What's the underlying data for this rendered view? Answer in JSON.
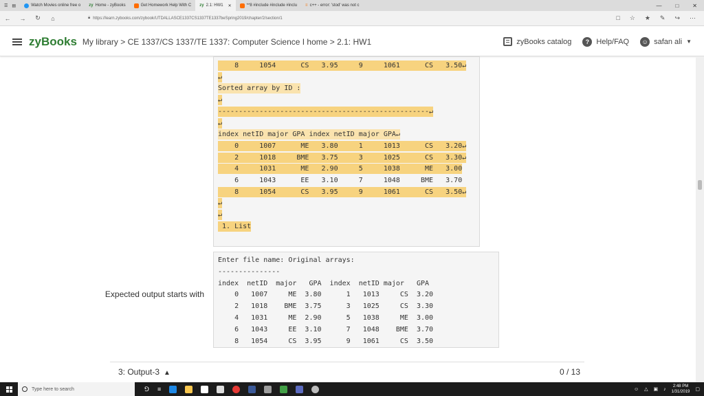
{
  "browser": {
    "tabs": [
      {
        "label": "Watch Movies online free o",
        "color": "#2196f3"
      },
      {
        "label": "Home - zyBooks",
        "color": "#ffffff"
      },
      {
        "label": "Get Homework Help With C",
        "color": "#ff6d00"
      },
      {
        "label": "2.1: HW1",
        "color": "#ffffff",
        "active": true
      },
      {
        "label": "**8 #include #include #inclu",
        "color": "#ff6d00"
      },
      {
        "label": "c++ - error: 'stod' was not c",
        "color": "#f0f0f0"
      }
    ],
    "url": "https://learn.zybooks.com/zybook/UTDALLASCE1337CS1337TE1337beSpring2019/chapter/2/section/1"
  },
  "header": {
    "brand": "zyBooks",
    "breadcrumb": "My library > CE 1337/CS 1337/TE 1337: Computer Science I home > 2.1: HW1",
    "catalog": "zyBooks catalog",
    "help": "Help/FAQ",
    "user": "safan ali"
  },
  "user_output": {
    "lines": [
      "    8     1054      CS   3.95     9     1061      CS   3.50↵",
      "↵",
      "Sorted array by ID :",
      "↵",
      "---------------------------------------------------↵",
      "↵",
      "index netID major GPA index netID major GPA↵",
      "    0     1007      ME   3.80     1     1013      CS   3.20↵",
      "    2     1018     BME   3.75     3     1025      CS   3.30↵",
      "    4     1031      ME   2.90     5     1038      ME   3.00",
      "    6     1043      EE   3.10     7     1048     BME   3.70",
      "    8     1054      CS   3.95     9     1061      CS   3.50↵",
      "↵",
      "↵",
      " 1. List"
    ]
  },
  "expected": {
    "label": "Expected output starts with",
    "lines": [
      "Enter file name: Original arrays:",
      "---------------",
      "index  netID  major   GPA  index  netID major   GPA",
      "    0   1007     ME  3.80      1   1013     CS  3.20",
      "    2   1018    BME  3.75      3   1025     CS  3.30",
      "    4   1031     ME  2.90      5   1038     ME  3.00",
      "    6   1043     EE  3.10      7   1048    BME  3.70",
      "    8   1054     CS  3.95      9   1061     CS  3.50"
    ]
  },
  "footer": {
    "section_label": "3: Output-3",
    "score": "0 / 13"
  },
  "taskbar": {
    "search_placeholder": "Type here to search",
    "time": "2:48 PM",
    "date": "1/31/2019"
  }
}
